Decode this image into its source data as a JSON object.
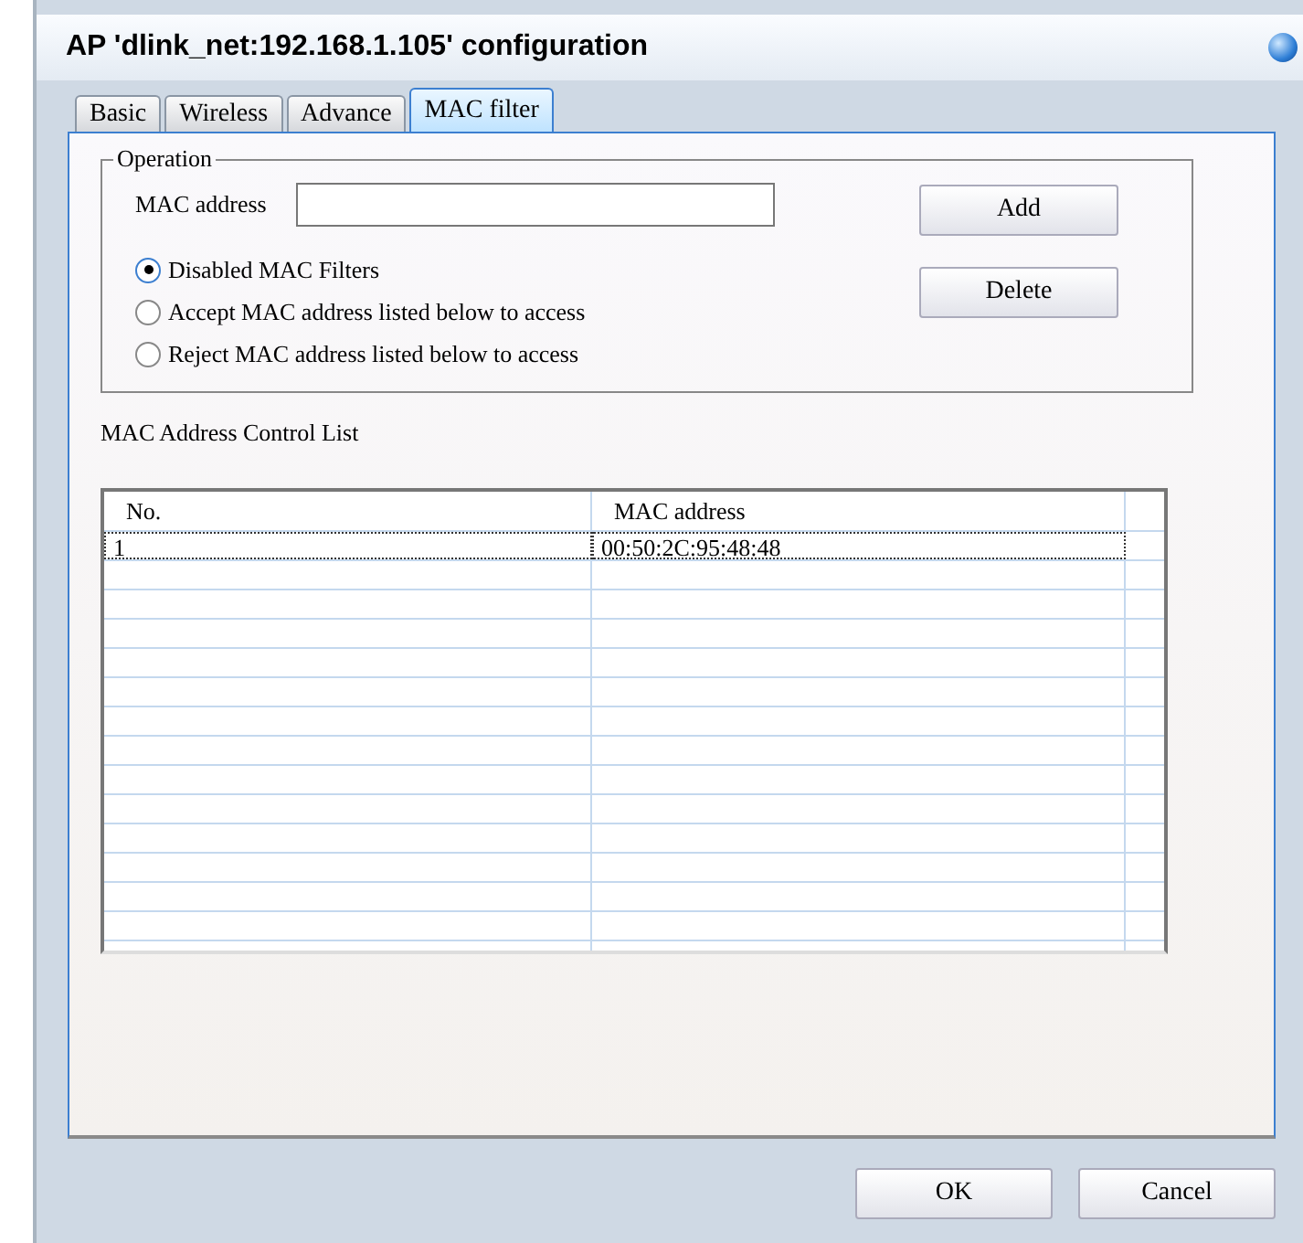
{
  "window": {
    "title": "AP 'dlink_net:192.168.1.105' configuration"
  },
  "tabs": [
    {
      "label": "Basic",
      "selected": false
    },
    {
      "label": "Wireless",
      "selected": false
    },
    {
      "label": "Advance",
      "selected": false
    },
    {
      "label": "MAC filter",
      "selected": true
    }
  ],
  "operation": {
    "legend": "Operation",
    "mac_label": "MAC address",
    "buttons": [
      "Add",
      "Delete"
    ],
    "options": [
      {
        "label": "Disabled MAC Filters",
        "selected": true
      },
      {
        "label": "Accept MAC address listed below to access",
        "selected": false
      },
      {
        "label": "Reject MAC address listed below to access",
        "selected": false
      }
    ]
  },
  "list": {
    "title": "MAC Address Control List",
    "columns": [
      "No.",
      "MAC address"
    ],
    "rows": [
      [
        "1",
        "00:50:2C:95:48:48"
      ]
    ]
  },
  "buttons": [
    "OK",
    "Cancel"
  ]
}
